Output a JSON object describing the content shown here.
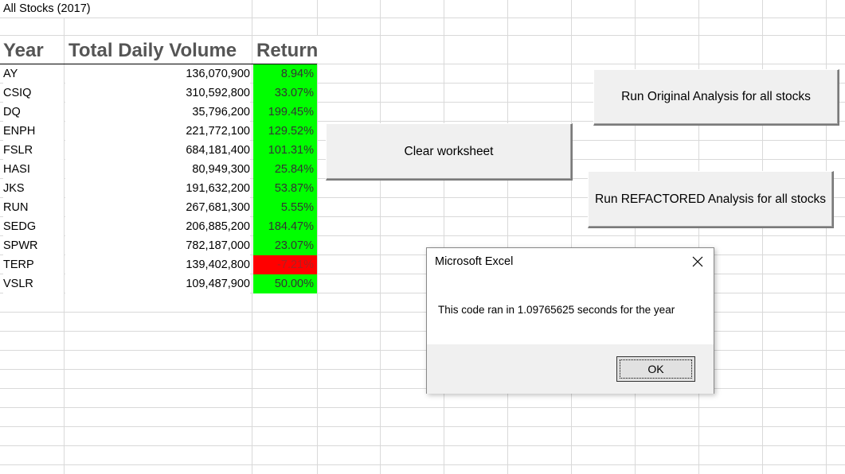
{
  "sheet": {
    "title": "All Stocks (2017)",
    "headers": {
      "year": "Year",
      "volume": "Total Daily Volume",
      "return": "Return"
    },
    "rows": [
      {
        "ticker": "AY",
        "volume": "136,070,900",
        "return": "8.94%",
        "color": "#00ff00",
        "text_color": "#333333"
      },
      {
        "ticker": "CSIQ",
        "volume": "310,592,800",
        "return": "33.07%",
        "color": "#00ff00",
        "text_color": "#333333"
      },
      {
        "ticker": "DQ",
        "volume": "35,796,200",
        "return": "199.45%",
        "color": "#00ff00",
        "text_color": "#333333"
      },
      {
        "ticker": "ENPH",
        "volume": "221,772,100",
        "return": "129.52%",
        "color": "#00ff00",
        "text_color": "#333333"
      },
      {
        "ticker": "FSLR",
        "volume": "684,181,400",
        "return": "101.31%",
        "color": "#00ff00",
        "text_color": "#333333"
      },
      {
        "ticker": "HASI",
        "volume": "80,949,300",
        "return": "25.84%",
        "color": "#00ff00",
        "text_color": "#333333"
      },
      {
        "ticker": "JKS",
        "volume": "191,632,200",
        "return": "53.87%",
        "color": "#00ff00",
        "text_color": "#333333"
      },
      {
        "ticker": "RUN",
        "volume": "267,681,300",
        "return": "5.55%",
        "color": "#00ff00",
        "text_color": "#333333"
      },
      {
        "ticker": "SEDG",
        "volume": "206,885,200",
        "return": "184.47%",
        "color": "#00ff00",
        "text_color": "#333333"
      },
      {
        "ticker": "SPWR",
        "volume": "782,187,000",
        "return": "23.07%",
        "color": "#00ff00",
        "text_color": "#333333"
      },
      {
        "ticker": "TERP",
        "volume": "139,402,800",
        "return": "-7.21%",
        "color": "#ff0000",
        "text_color": "#aa2222"
      },
      {
        "ticker": "VSLR",
        "volume": "109,487,900",
        "return": "50.00%",
        "color": "#00ff00",
        "text_color": "#333333"
      }
    ]
  },
  "buttons": {
    "run_original": "Run Original Analysis for all stocks",
    "clear": "Clear worksheet",
    "run_refactored": "Run REFACTORED Analysis for all stocks"
  },
  "dialog": {
    "title": "Microsoft Excel",
    "message": "This code ran in 1.09765625 seconds for the year",
    "ok_label": "OK",
    "close_icon": "close-icon"
  }
}
